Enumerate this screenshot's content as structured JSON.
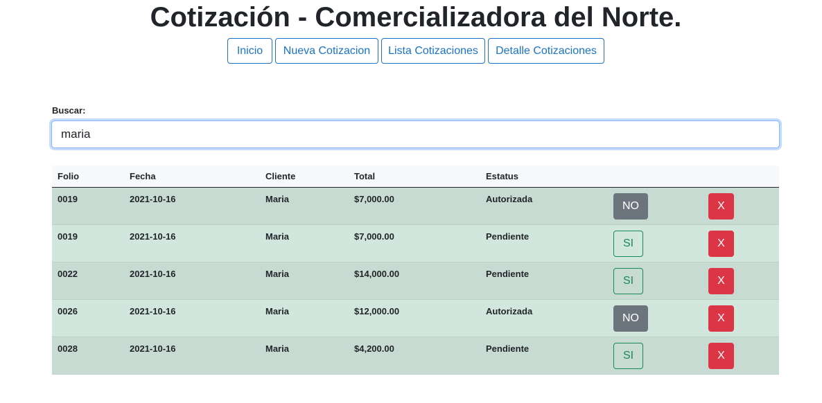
{
  "header": {
    "title": "Cotización - Comercializadora del Norte."
  },
  "nav": {
    "items": [
      {
        "label": "Inicio"
      },
      {
        "label": "Nueva Cotizacion"
      },
      {
        "label": "Lista Cotizaciones"
      },
      {
        "label": "Detalle Cotizaciones"
      }
    ]
  },
  "search": {
    "label": "Buscar:",
    "value": "maria"
  },
  "table": {
    "columns": [
      "Folio",
      "Fecha",
      "Cliente",
      "Total",
      "Estatus"
    ],
    "rows": [
      {
        "folio": "0019",
        "fecha": "2021-10-16",
        "cliente": "Maria",
        "total": "$7,000.00",
        "estatus": "Autorizada",
        "toggle": "NO",
        "delete": "X"
      },
      {
        "folio": "0019",
        "fecha": "2021-10-16",
        "cliente": "Maria",
        "total": "$7,000.00",
        "estatus": "Pendiente",
        "toggle": "SI",
        "delete": "X"
      },
      {
        "folio": "0022",
        "fecha": "2021-10-16",
        "cliente": "Maria",
        "total": "$14,000.00",
        "estatus": "Pendiente",
        "toggle": "SI",
        "delete": "X"
      },
      {
        "folio": "0026",
        "fecha": "2021-10-16",
        "cliente": "Maria",
        "total": "$12,000.00",
        "estatus": "Autorizada",
        "toggle": "NO",
        "delete": "X"
      },
      {
        "folio": "0028",
        "fecha": "2021-10-16",
        "cliente": "Maria",
        "total": "$4,200.00",
        "estatus": "Pendiente",
        "toggle": "SI",
        "delete": "X"
      }
    ]
  },
  "colors": {
    "primary": "#1a73c9",
    "secondary": "#6c757d",
    "success": "#198754",
    "danger": "#dc3545",
    "row_odd": "#c7dbd2",
    "row_even": "#d1e7dd"
  }
}
